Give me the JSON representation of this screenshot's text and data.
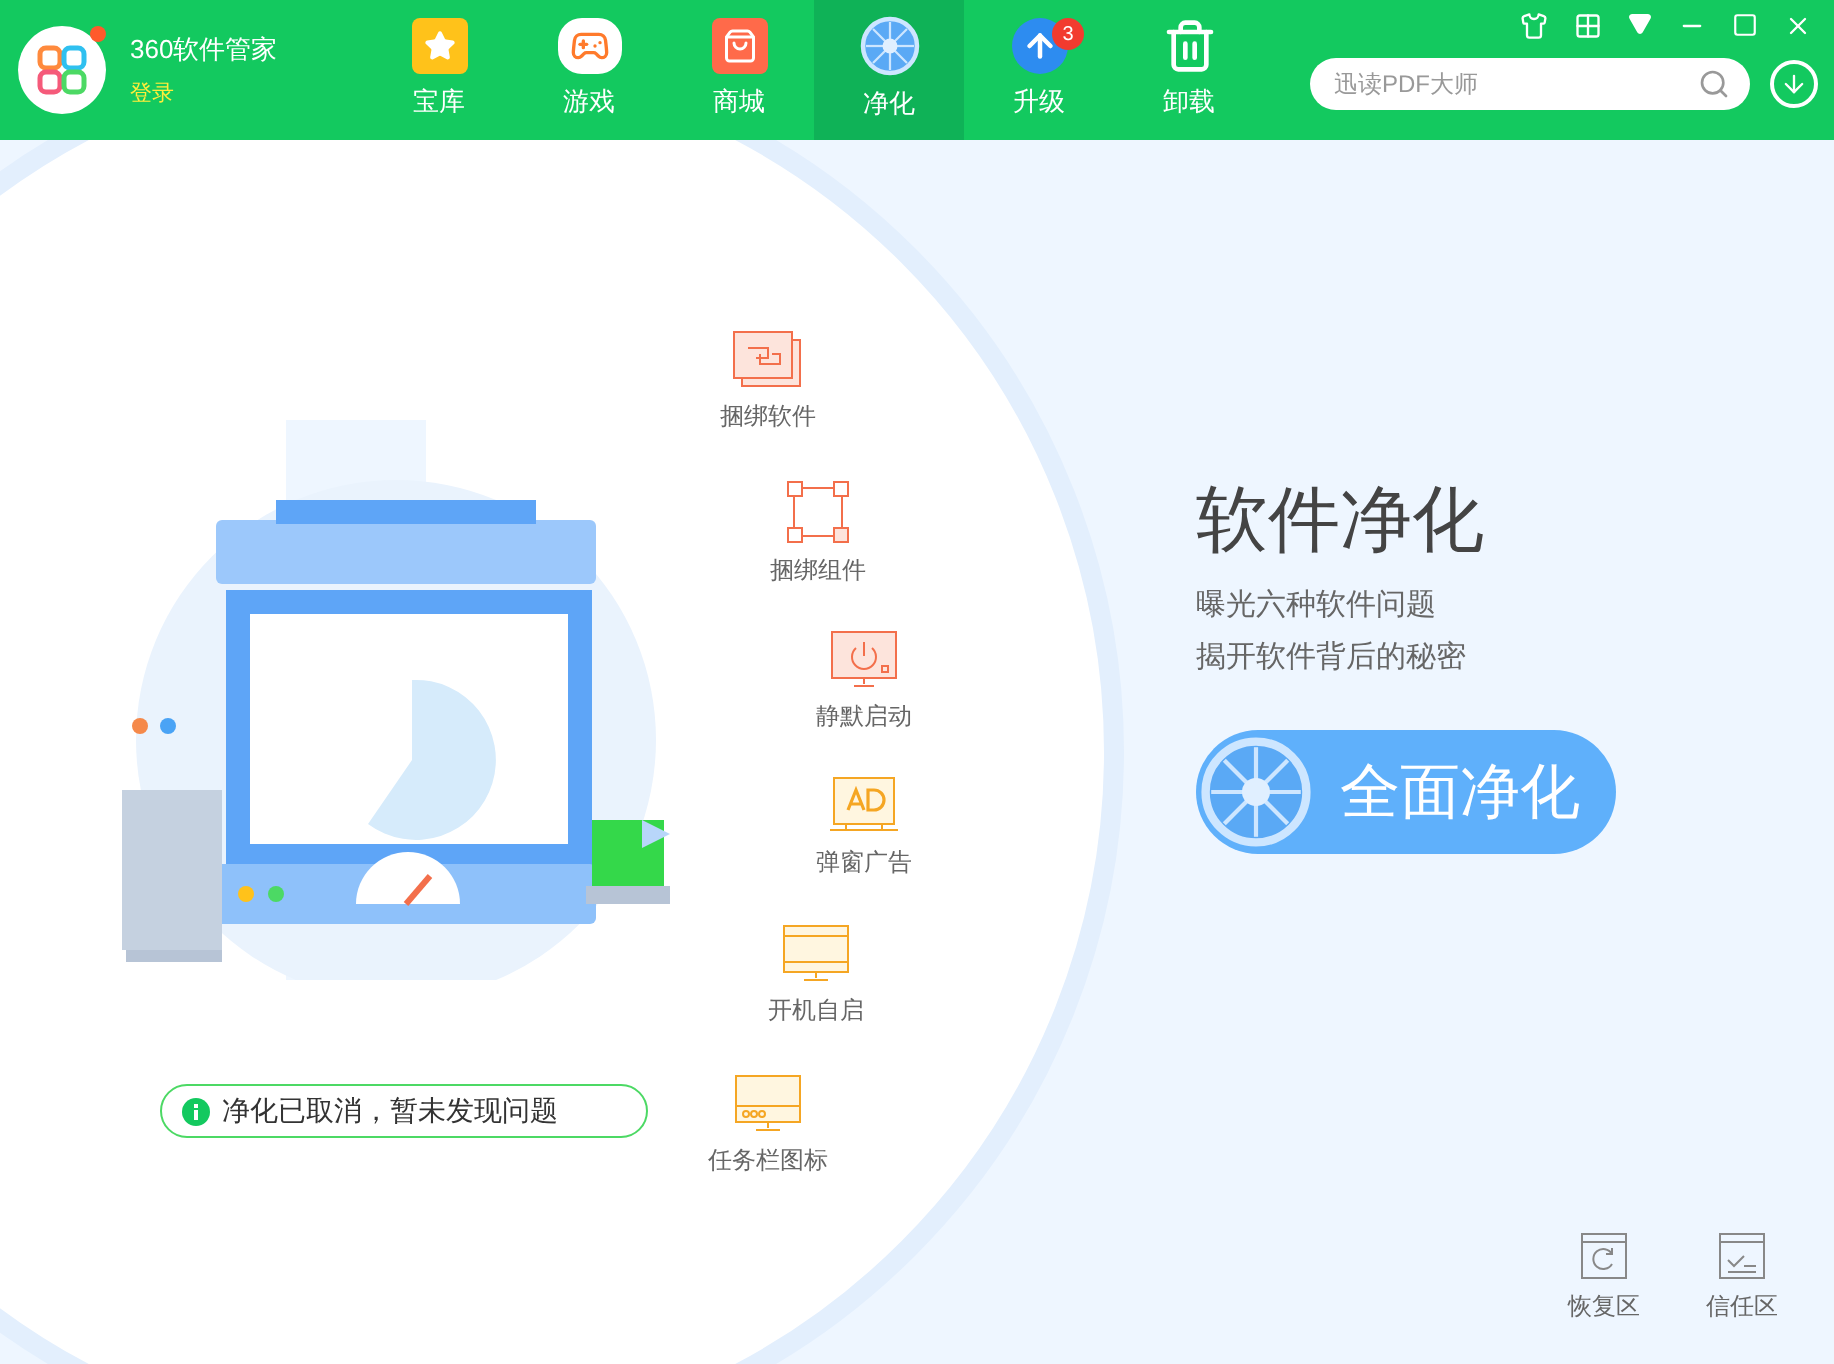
{
  "app": {
    "name": "360软件管家",
    "login": "登录",
    "notification_dot": true
  },
  "tabs": [
    {
      "label": "宝库",
      "kind": "star",
      "selected": false
    },
    {
      "label": "游戏",
      "kind": "game",
      "selected": false
    },
    {
      "label": "商城",
      "kind": "bag",
      "selected": false
    },
    {
      "label": "净化",
      "kind": "fan",
      "selected": true
    },
    {
      "label": "升级",
      "kind": "upgrade",
      "selected": false,
      "badge": "3"
    },
    {
      "label": "卸载",
      "kind": "trash",
      "selected": false
    }
  ],
  "search": {
    "placeholder": "迅读PDF大师"
  },
  "issues": [
    {
      "label": "捆绑软件",
      "kind": "bundle"
    },
    {
      "label": "捆绑组件",
      "kind": "component"
    },
    {
      "label": "静默启动",
      "kind": "power"
    },
    {
      "label": "弹窗广告",
      "kind": "ad"
    },
    {
      "label": "开机自启",
      "kind": "boot"
    },
    {
      "label": "任务栏图标",
      "kind": "taskbar"
    }
  ],
  "status": "净化已取消，暂未发现问题",
  "panel": {
    "title": "软件净化",
    "lines": [
      "曝光六种软件问题",
      "揭开软件背后的秘密"
    ],
    "button": "全面净化"
  },
  "footer": [
    {
      "label": "恢复区",
      "kind": "restore"
    },
    {
      "label": "信任区",
      "kind": "trust"
    }
  ]
}
